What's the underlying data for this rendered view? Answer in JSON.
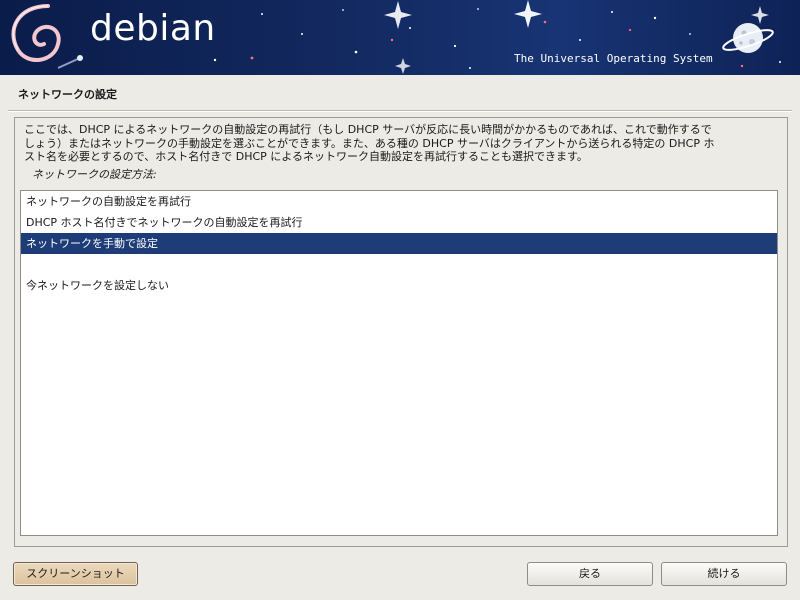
{
  "header": {
    "brand": "debian",
    "tagline": "The Universal Operating System"
  },
  "page": {
    "title": "ネットワークの設定"
  },
  "main": {
    "description_lines": [
      "ここでは、DHCP によるネットワークの自動設定の再試行（もし DHCP サーバが反応に長い時間がかかるものであれば、これで動作するで",
      "しょう）またはネットワークの手動設定を選ぶことができます。また、ある種の DHCP サーバはクライアントから送られる特定の DHCP ホ",
      "スト名を必要とするので、ホスト名付きで DHCP によるネットワーク自動設定を再試行することも選択できます。"
    ],
    "prompt": "ネットワークの設定方法:",
    "options": [
      {
        "label": "ネットワークの自動設定を再試行"
      },
      {
        "label": "DHCP ホスト名付きでネットワークの自動設定を再試行"
      },
      {
        "label": "ネットワークを手動で設定",
        "selected": true
      },
      {
        "label": ""
      },
      {
        "label": "今ネットワークを設定しない"
      }
    ]
  },
  "footer": {
    "screenshot_label": "スクリーンショット",
    "back_label": "戻る",
    "continue_label": "続ける"
  },
  "colors": {
    "banner_dark": "#0a1c4a",
    "selection": "#1e3d78",
    "background": "#ecebe6"
  }
}
